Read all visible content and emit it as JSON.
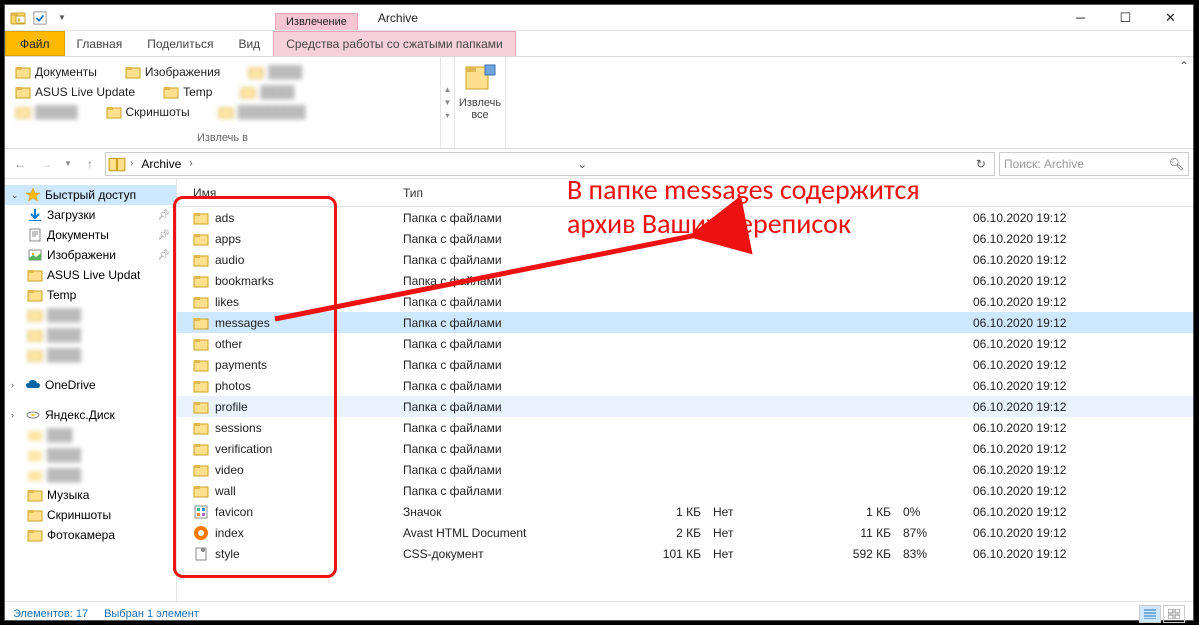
{
  "titlebar": {
    "context_tab": "Извлечение",
    "title": "Archive"
  },
  "ribbon": {
    "tabs": [
      "Файл",
      "Главная",
      "Поделиться",
      "Вид",
      "Средства работы со сжатыми папками"
    ],
    "extract": {
      "destinations": [
        "Документы",
        "Изображения",
        "ASUS Live Update",
        "Temp",
        "Скриншоты"
      ],
      "group_label": "Извлечь в",
      "extract_all": "Извлечь\nвсе"
    }
  },
  "address": {
    "crumbs": [
      "Archive"
    ],
    "search_placeholder": "Поиск: Archive"
  },
  "navpane": {
    "quick_access": "Быстрый доступ",
    "items": [
      "Загрузки",
      "Документы",
      "Изображени",
      "ASUS Live Updat",
      "Temp"
    ],
    "onedrive": "OneDrive",
    "yandex": "Яндекс.Диск",
    "items2": [
      "Музыка",
      "Скриншоты",
      "Фотокамера"
    ]
  },
  "columns": {
    "name": "Имя",
    "type": "Тип",
    "csize": "",
    "folder": "",
    "osize": "",
    "ratio": "",
    "date": ""
  },
  "files": [
    {
      "name": "ads",
      "type": "Папка с файлами",
      "csize": "",
      "folder": "",
      "osize": "",
      "ratio": "",
      "date": "06.10.2020 19:12",
      "icon": "folder"
    },
    {
      "name": "apps",
      "type": "Папка с файлами",
      "csize": "",
      "folder": "",
      "osize": "",
      "ratio": "",
      "date": "06.10.2020 19:12",
      "icon": "folder"
    },
    {
      "name": "audio",
      "type": "Папка с файлами",
      "csize": "",
      "folder": "",
      "osize": "",
      "ratio": "",
      "date": "06.10.2020 19:12",
      "icon": "folder"
    },
    {
      "name": "bookmarks",
      "type": "Папка с файлами",
      "csize": "",
      "folder": "",
      "osize": "",
      "ratio": "",
      "date": "06.10.2020 19:12",
      "icon": "folder"
    },
    {
      "name": "likes",
      "type": "Папка с файлами",
      "csize": "",
      "folder": "",
      "osize": "",
      "ratio": "",
      "date": "06.10.2020 19:12",
      "icon": "folder"
    },
    {
      "name": "messages",
      "type": "Папка с файлами",
      "csize": "",
      "folder": "",
      "osize": "",
      "ratio": "",
      "date": "06.10.2020 19:12",
      "icon": "folder",
      "sel": true
    },
    {
      "name": "other",
      "type": "Папка с файлами",
      "csize": "",
      "folder": "",
      "osize": "",
      "ratio": "",
      "date": "06.10.2020 19:12",
      "icon": "folder"
    },
    {
      "name": "payments",
      "type": "Папка с файлами",
      "csize": "",
      "folder": "",
      "osize": "",
      "ratio": "",
      "date": "06.10.2020 19:12",
      "icon": "folder"
    },
    {
      "name": "photos",
      "type": "Папка с файлами",
      "csize": "",
      "folder": "",
      "osize": "",
      "ratio": "",
      "date": "06.10.2020 19:12",
      "icon": "folder"
    },
    {
      "name": "profile",
      "type": "Папка с файлами",
      "csize": "",
      "folder": "",
      "osize": "",
      "ratio": "",
      "date": "06.10.2020 19:12",
      "icon": "folder",
      "hov": true
    },
    {
      "name": "sessions",
      "type": "Папка с файлами",
      "csize": "",
      "folder": "",
      "osize": "",
      "ratio": "",
      "date": "06.10.2020 19:12",
      "icon": "folder"
    },
    {
      "name": "verification",
      "type": "Папка с файлами",
      "csize": "",
      "folder": "",
      "osize": "",
      "ratio": "",
      "date": "06.10.2020 19:12",
      "icon": "folder"
    },
    {
      "name": "video",
      "type": "Папка с файлами",
      "csize": "",
      "folder": "",
      "osize": "",
      "ratio": "",
      "date": "06.10.2020 19:12",
      "icon": "folder"
    },
    {
      "name": "wall",
      "type": "Папка с файлами",
      "csize": "",
      "folder": "",
      "osize": "",
      "ratio": "",
      "date": "06.10.2020 19:12",
      "icon": "folder"
    },
    {
      "name": "favicon",
      "type": "Значок",
      "csize": "1 КБ",
      "folder": "Нет",
      "osize": "1 КБ",
      "ratio": "0%",
      "date": "06.10.2020 19:12",
      "icon": "ico"
    },
    {
      "name": "index",
      "type": "Avast HTML Document",
      "csize": "2 КБ",
      "folder": "Нет",
      "osize": "11 КБ",
      "ratio": "87%",
      "date": "06.10.2020 19:12",
      "icon": "avast"
    },
    {
      "name": "style",
      "type": "CSS-документ",
      "csize": "101 КБ",
      "folder": "Нет",
      "osize": "592 КБ",
      "ratio": "83%",
      "date": "06.10.2020 19:12",
      "icon": "css"
    }
  ],
  "status": {
    "count": "Элементов: 17",
    "selected": "Выбран 1 элемент"
  },
  "annotation": {
    "line1": "В папке messages содержится",
    "line2": "архив Ваших переписок"
  }
}
